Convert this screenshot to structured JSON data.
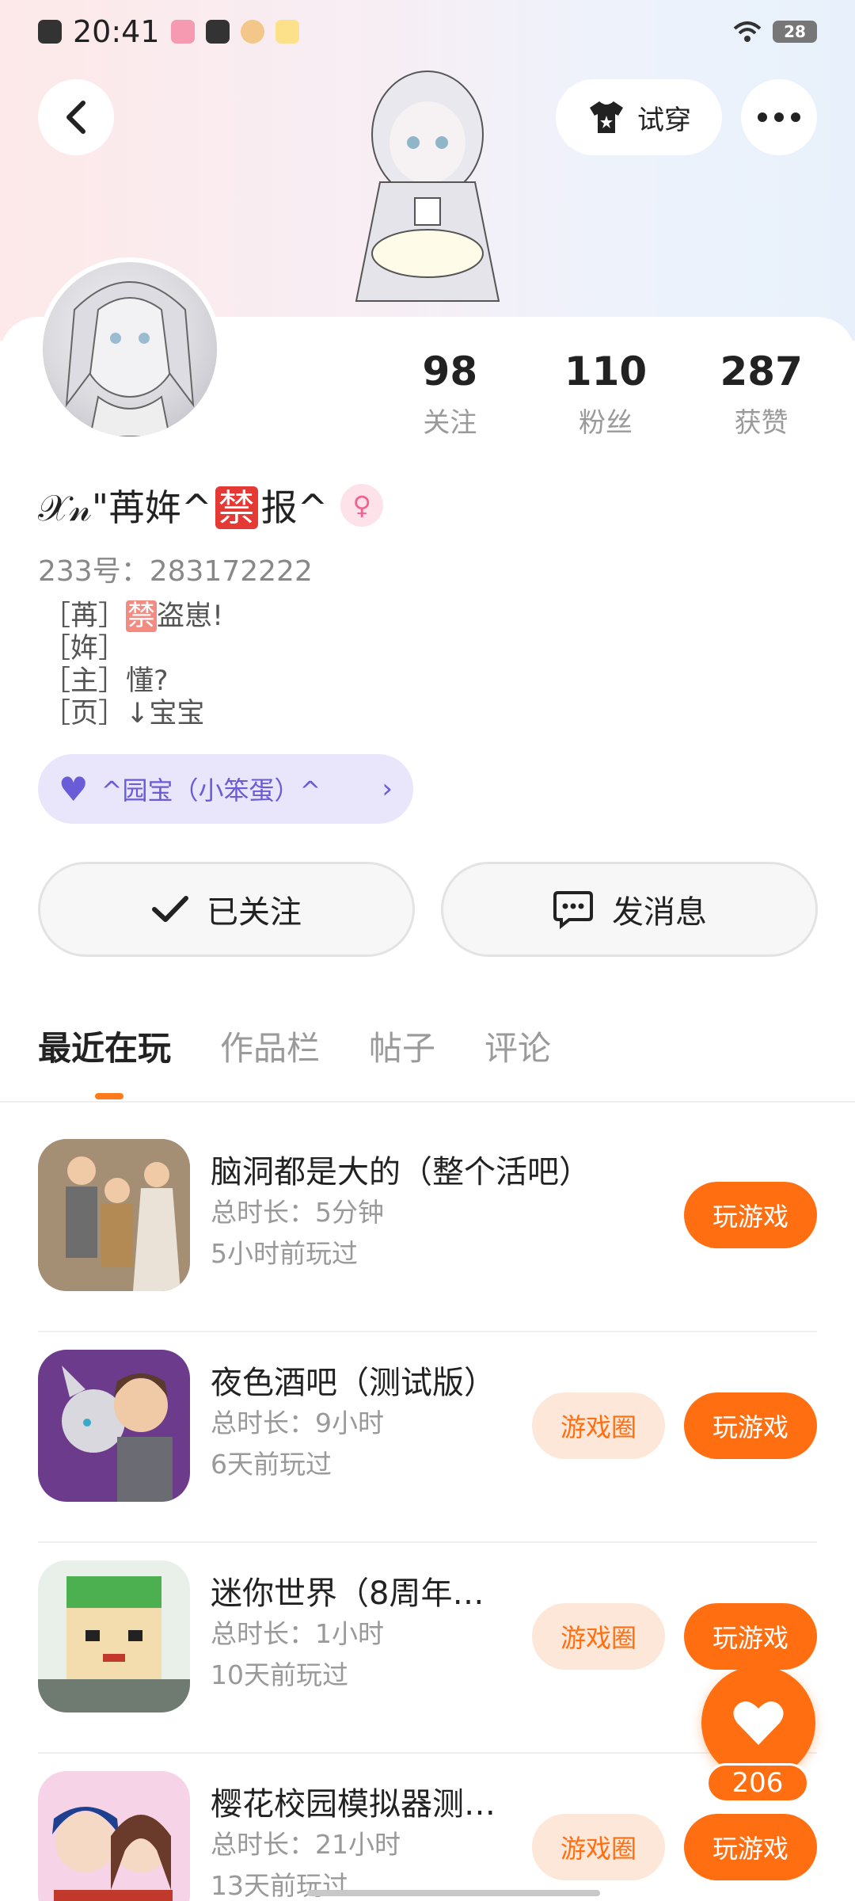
{
  "status_bar": {
    "time": "20:41",
    "battery": "28",
    "icons": [
      "close-box-icon",
      "notification-app-icon",
      "notification-square-icon",
      "monkey-app-icon",
      "score-app-icon",
      "wifi-icon",
      "battery-icon"
    ]
  },
  "header": {
    "tryon_label": "试穿",
    "icons": [
      "back-arrow-icon",
      "tshirt-icon",
      "more-dots-icon"
    ]
  },
  "profile": {
    "stats": [
      {
        "value": "98",
        "label": "关注"
      },
      {
        "value": "110",
        "label": "粉丝"
      },
      {
        "value": "287",
        "label": "获赞"
      }
    ],
    "username_prefix": "𝒳𝓃\"苒姩^",
    "username_banned_badge": "禁",
    "username_suffix": "报^",
    "gender_symbol": "♀",
    "uid": "233号：283172222",
    "bio_lines": [
      "［苒］",
      "［姩］",
      "［主］懂?",
      "［页］↓宝宝"
    ],
    "bio_line1_badge": "禁",
    "bio_line1_suffix": "盗崽!",
    "guild_label": "^园宝（小笨蛋）^"
  },
  "actions": {
    "follow_label": "已关注",
    "message_label": "发消息"
  },
  "tabs": [
    {
      "label": "最近在玩",
      "active": true
    },
    {
      "label": "作品栏",
      "active": false
    },
    {
      "label": "帖子",
      "active": false
    },
    {
      "label": "评论",
      "active": false
    }
  ],
  "games": [
    {
      "title": "脑洞都是大的（整个活吧）",
      "duration": "总时长：5分钟",
      "last_played": "5小时前玩过",
      "has_circle": false
    },
    {
      "title": "夜色酒吧（测试版）",
      "duration": "总时长：9小时",
      "last_played": "6天前玩过",
      "has_circle": true
    },
    {
      "title": "迷你世界（8周年…",
      "duration": "总时长：1小时",
      "last_played": "10天前玩过",
      "has_circle": true
    },
    {
      "title": "樱花校园模拟器测…",
      "duration": "总时长：21小时",
      "last_played": "13天前玩过",
      "has_circle": true
    }
  ],
  "game_buttons": {
    "play_label": "玩游戏",
    "circle_label": "游戏圈"
  },
  "like_fab": {
    "count": "206"
  },
  "colors": {
    "accent": "#ff6f12",
    "guild_bg": "#e9e5fb",
    "guild_text": "#6a5bd6"
  }
}
